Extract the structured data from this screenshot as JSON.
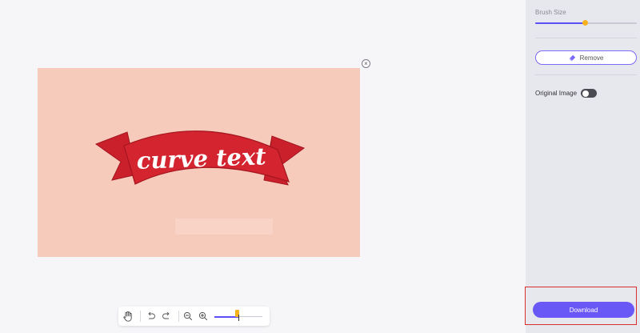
{
  "canvas": {
    "close_glyph": "×",
    "banner_text": "curve text"
  },
  "toolbar": {
    "icons": [
      "hand-icon",
      "undo-icon",
      "redo-icon",
      "zoom-out-icon",
      "zoom-in-icon"
    ],
    "zoom_level": 0.5
  },
  "sidebar": {
    "brush_size_label": "Brush Size",
    "brush_size_value": 0.49,
    "remove_label": "Remove",
    "original_image_label": "Original Image",
    "original_image_on": false,
    "download_label": "Download"
  },
  "colors": {
    "accent": "#6a58f6",
    "thumb": "#f6b21c",
    "image_background": "#f6cbbb",
    "banner": "#c9202c",
    "highlight_box": "#d9302e"
  }
}
